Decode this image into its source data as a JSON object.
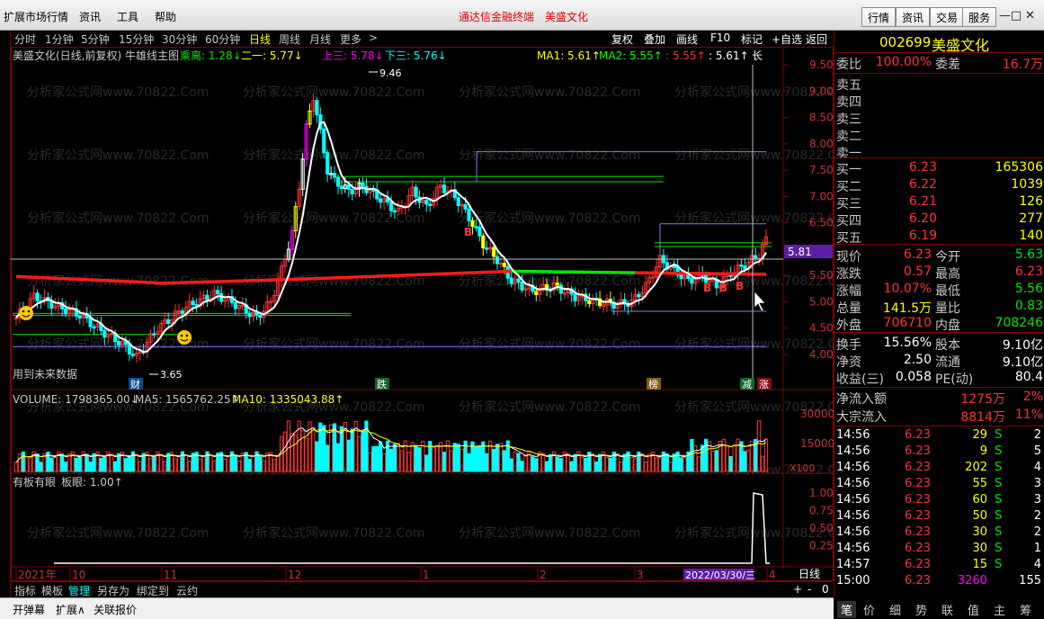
{
  "titlebar": {
    "menus": [
      "扩展市场行情",
      "资讯",
      "工具",
      "帮助"
    ],
    "app_name": "通达信金融终端",
    "stock_title": "美盛文化",
    "buttons": [
      "行情",
      "资讯",
      "交易",
      "服务"
    ],
    "win_controls": [
      "—",
      "□",
      "✕"
    ]
  },
  "periods": [
    "分时",
    "1分钟",
    "5分钟",
    "15分钟",
    "30分钟",
    "60分钟",
    "日线",
    "周线",
    "月线",
    "更多",
    ">"
  ],
  "active_period": "日线",
  "chart_tools": [
    "复权",
    "叠加",
    "画线",
    "F10",
    "标记",
    "+自选",
    "返回"
  ],
  "main_legend": {
    "name": "美盛文化(日线,前复权) 牛雄线主图",
    "chengli": "乘离: 1.28↓",
    "yier": "二一: 5.77↓",
    "shangsan": "上三: 5.78↓",
    "xiasan": "下三: 5.76↓",
    "ma1": "MA1: 5.61↑",
    "ma2": "MA2: 5.55↑",
    "v1": ": 5.55↑",
    "v2": ": 5.61↑",
    "long": "长"
  },
  "price_axis": [
    "9.50",
    "9.00",
    "8.50",
    "8.00",
    "7.50",
    "7.00",
    "6.50",
    "6.00",
    "5.50",
    "5.00",
    "4.50",
    "4.00"
  ],
  "current_price_tag": "5.81",
  "annotations": {
    "high_label": "9.46",
    "low_label": "3.65",
    "future_note": "用到未来数据",
    "bottom_tags": [
      "财",
      "跌",
      "榜",
      "减",
      "涨"
    ]
  },
  "volume_legend": {
    "volume": "VOLUME: 1798365.00↓",
    "ma5": "MA5: 1565762.25↑",
    "ma10": "MA10: 1335043.88↑"
  },
  "volume_axis": [
    "30000",
    "15000",
    "X100"
  ],
  "indicator_legend": {
    "name": "有板有眼",
    "value": "板眼: 1.00↑"
  },
  "indicator_axis": [
    "1.00",
    "0.75",
    "0.50",
    "0.25"
  ],
  "date_axis": [
    "2021年",
    "10",
    "11",
    "12",
    "1",
    "2",
    "3",
    "4"
  ],
  "date_cursor": "2022/03/30/三",
  "period_label": "日线",
  "scroll_ctl": [
    "+",
    "-",
    "0"
  ],
  "bottom_tabs": [
    "指标",
    "模板",
    "管理",
    "另存为",
    "绑定到",
    "云约"
  ],
  "status_items": [
    "开弹幕",
    "扩展∧",
    "关联报价"
  ],
  "quote": {
    "code": "002699",
    "name": "美盛文化",
    "weibi_label": "委比",
    "weibi": "100.00%",
    "weicha_label": "委差",
    "weicha": "16.7万",
    "sells": [
      {
        "label": "卖五",
        "price": "",
        "vol": ""
      },
      {
        "label": "卖四",
        "price": "",
        "vol": ""
      },
      {
        "label": "卖三",
        "price": "",
        "vol": ""
      },
      {
        "label": "卖二",
        "price": "",
        "vol": ""
      },
      {
        "label": "卖一",
        "price": "",
        "vol": ""
      }
    ],
    "buys": [
      {
        "label": "买一",
        "price": "6.23",
        "vol": "165306"
      },
      {
        "label": "买二",
        "price": "6.22",
        "vol": "1039"
      },
      {
        "label": "买三",
        "price": "6.21",
        "vol": "126"
      },
      {
        "label": "买四",
        "price": "6.20",
        "vol": "277"
      },
      {
        "label": "买五",
        "price": "6.19",
        "vol": "140"
      }
    ],
    "stats": [
      {
        "l1": "现价",
        "v1": "6.23",
        "c1": "red",
        "l2": "今开",
        "v2": "5.63",
        "c2": "green"
      },
      {
        "l1": "涨跌",
        "v1": "0.57",
        "c1": "red",
        "l2": "最高",
        "v2": "6.23",
        "c2": "red"
      },
      {
        "l1": "涨幅",
        "v1": "10.07%",
        "c1": "red",
        "l2": "最低",
        "v2": "5.56",
        "c2": "green"
      },
      {
        "l1": "总量",
        "v1": "141.5万",
        "c1": "yellow",
        "l2": "量比",
        "v2": "0.83",
        "c2": "green"
      },
      {
        "l1": "外盘",
        "v1": "706710",
        "c1": "red",
        "l2": "内盘",
        "v2": "708246",
        "c2": "green"
      }
    ],
    "stats2": [
      {
        "l1": "换手",
        "v1": "15.56%",
        "l2": "股本",
        "v2": "9.10亿"
      },
      {
        "l1": "净资",
        "v1": "2.50",
        "l2": "流通",
        "v2": "9.10亿"
      },
      {
        "l1": "收益(三)",
        "v1": "0.058",
        "l2": "PE(动)",
        "v2": "80.4"
      }
    ],
    "netflow_label": "净流入额",
    "netflow": "1275万",
    "netflow_pct": "2%",
    "bigflow_label": "大宗流入",
    "bigflow": "8814万",
    "bigflow_pct": "11%",
    "ticks": [
      {
        "t": "14:56",
        "p": "6.23",
        "v": "29",
        "s": "S",
        "n": "2"
      },
      {
        "t": "14:56",
        "p": "6.23",
        "v": "9",
        "s": "S",
        "n": "5"
      },
      {
        "t": "14:56",
        "p": "6.23",
        "v": "202",
        "s": "S",
        "n": "4"
      },
      {
        "t": "14:56",
        "p": "6.23",
        "v": "55",
        "s": "S",
        "n": "3"
      },
      {
        "t": "14:56",
        "p": "6.23",
        "v": "60",
        "s": "S",
        "n": "3"
      },
      {
        "t": "14:56",
        "p": "6.23",
        "v": "50",
        "s": "S",
        "n": "2"
      },
      {
        "t": "14:56",
        "p": "6.23",
        "v": "30",
        "s": "S",
        "n": "2"
      },
      {
        "t": "14:56",
        "p": "6.23",
        "v": "30",
        "s": "S",
        "n": "1"
      },
      {
        "t": "14:57",
        "p": "6.23",
        "v": "15",
        "s": "S",
        "n": "4"
      },
      {
        "t": "15:00",
        "p": "6.23",
        "v": "3260",
        "s": "",
        "n": "155"
      }
    ]
  },
  "right_tabs": [
    "笔",
    "价",
    "细",
    "势",
    "联",
    "值",
    "主",
    "筹"
  ],
  "watermark": "分析家公式网www.70822.Com",
  "colors": {
    "up": "#ff3232",
    "down": "#00ffff",
    "ma_white": "#ffffff",
    "long_red": "#ff1a1a",
    "long_green": "#00e600",
    "frame": "#800000"
  }
}
